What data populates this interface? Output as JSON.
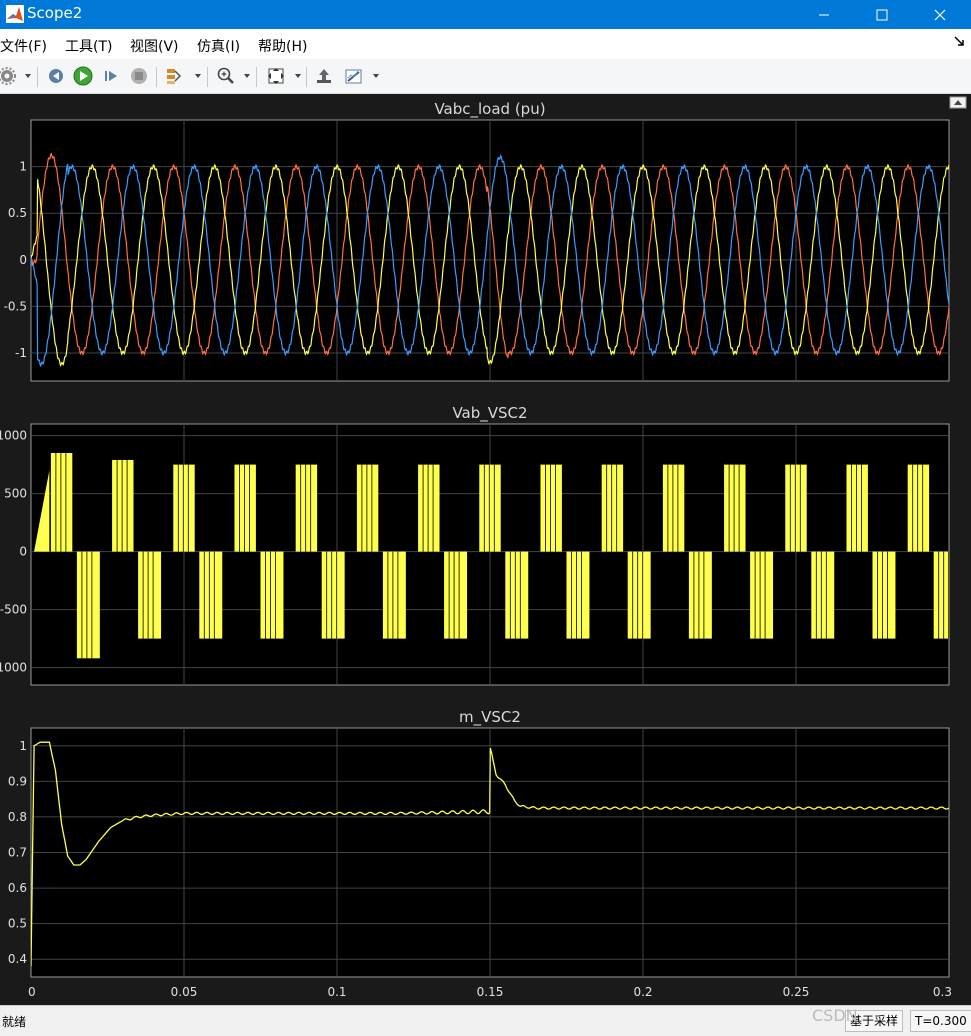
{
  "window": {
    "title": "Scope2"
  },
  "menu": [
    "文件(F)",
    "工具(T)",
    "视图(V)",
    "仿真(I)",
    "帮助(H)"
  ],
  "toolbar": {
    "icons": [
      "gear-icon",
      "step-back-icon",
      "run-icon",
      "step-forward-icon",
      "stop-icon",
      "highlight-icon",
      "zoom-icon",
      "autoscale-icon",
      "restore-icon",
      "measure-icon"
    ]
  },
  "status": {
    "left": "就绪",
    "sample": "基于采样",
    "time": "T=0.300"
  },
  "watermark": "CSDN",
  "colors": {
    "phase_a": "#ff7040",
    "phase_b": "#ffff4d",
    "phase_c": "#3a9cff",
    "axes_text": "#e0e0e0",
    "grid": "#444444",
    "plot_bg": "#000000",
    "figure_bg": "#1a1a1a"
  },
  "chart_data": [
    {
      "type": "line",
      "title": "Vabc_load (pu)",
      "xlim": [
        0,
        0.3
      ],
      "ylim": [
        -1.3,
        1.5
      ],
      "yticks": [
        1,
        0.5,
        0,
        -0.5,
        -1
      ],
      "ytick_labels": [
        "1",
        "0.5",
        "0",
        "-0.5",
        "-1"
      ],
      "grid": true,
      "frequency_hz": 50,
      "amplitude_pu": 1.0,
      "series": [
        {
          "values_desc": "three-phase 50 Hz sinusoid, ~1 pu amplitude, transient to ~1.1 / -1.15 near t=0.005 and disturbance at t=0.15",
          "phase_deg": -30,
          "color_key": "phase_a"
        },
        {
          "values_desc": "three-phase 50 Hz sinusoid",
          "phase_deg": 90,
          "color_key": "phase_b"
        },
        {
          "values_desc": "three-phase 50 Hz sinusoid",
          "phase_deg": 210,
          "color_key": "phase_c"
        }
      ],
      "events": [
        {
          "x": 0.15,
          "desc": "step disturbance"
        }
      ]
    },
    {
      "type": "line",
      "title": "Vab_VSC2",
      "xlim": [
        0,
        0.3
      ],
      "ylim": [
        -1150,
        1100
      ],
      "yticks": [
        1000,
        500,
        0,
        -500,
        -1000
      ],
      "ytick_labels": [
        "1000",
        "500",
        "0",
        "-500",
        "-1000"
      ],
      "grid": true,
      "frequency_hz": 50,
      "pulse_amplitude": 750,
      "peaks": [
        {
          "x": 0.008,
          "y": 850
        },
        {
          "x": 0.012,
          "y": -920
        },
        {
          "x": 0.018,
          "y": 870
        }
      ],
      "series": [
        {
          "values_desc": "PWM pulse train, positive half ~+750, negative half ~-750 V",
          "color_key": "phase_b"
        }
      ]
    },
    {
      "type": "line",
      "title": "m_VSC2",
      "xlim": [
        0,
        0.3
      ],
      "ylim": [
        0.35,
        1.05
      ],
      "yticks": [
        1,
        0.9,
        0.8,
        0.7,
        0.6,
        0.5,
        0.4
      ],
      "ytick_labels": [
        "1",
        "0.9",
        "0.8",
        "0.7",
        "0.6",
        "0.5",
        "0.4"
      ],
      "xticks": [
        0,
        0.05,
        0.1,
        0.15,
        0.2,
        0.25,
        0.3
      ],
      "xtick_labels": [
        "0",
        "0.05",
        "0.1",
        "0.15",
        "0.2",
        "0.25",
        "0.3"
      ],
      "grid": true,
      "series": [
        {
          "color_key": "phase_b",
          "x": [
            0,
            0.001,
            0.003,
            0.006,
            0.008,
            0.01,
            0.012,
            0.014,
            0.016,
            0.018,
            0.022,
            0.026,
            0.03,
            0.035,
            0.04,
            0.05,
            0.08,
            0.12,
            0.1499,
            0.1501,
            0.152,
            0.155,
            0.158,
            0.16,
            0.165,
            0.17,
            0.2,
            0.25,
            0.3
          ],
          "y": [
            0.38,
            1.0,
            1.01,
            1.01,
            0.93,
            0.78,
            0.69,
            0.665,
            0.665,
            0.68,
            0.73,
            0.77,
            0.79,
            0.8,
            0.805,
            0.81,
            0.81,
            0.81,
            0.815,
            0.99,
            0.92,
            0.89,
            0.845,
            0.83,
            0.825,
            0.825,
            0.825,
            0.825,
            0.825
          ]
        }
      ]
    }
  ]
}
